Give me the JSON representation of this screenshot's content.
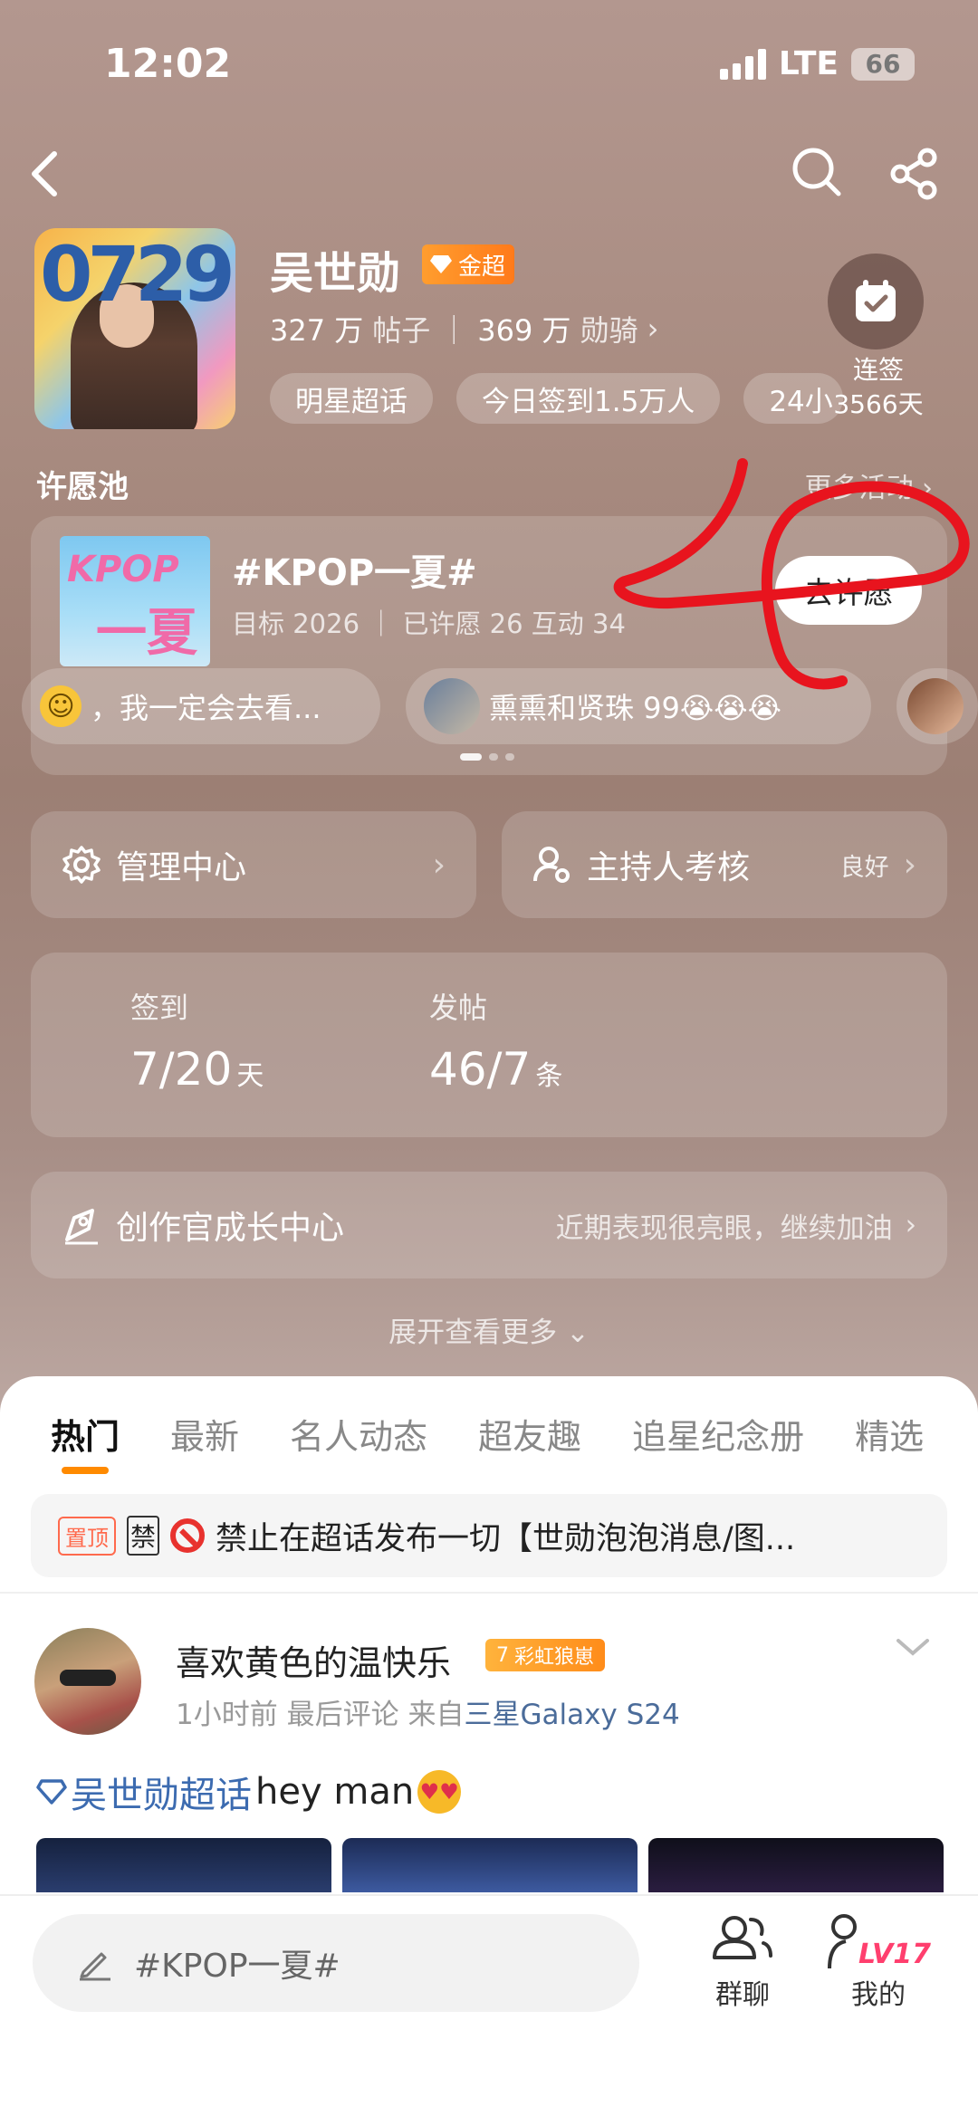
{
  "status_bar": {
    "time": "12:02",
    "network": "LTE",
    "battery": "66"
  },
  "topic": {
    "name": "吴世勋",
    "badge": "金超",
    "posts_count": "327 万",
    "posts_label": "帖子",
    "knights_count": "369 万",
    "knights_label": "勋骑",
    "avatar_text": "0729",
    "chips": [
      "明星超话",
      "今日签到1.5万人",
      "24小"
    ],
    "streak_label": "连签",
    "streak_days": "3566天"
  },
  "wish_pool": {
    "section_title": "许愿池",
    "more_link": "更多活动",
    "title": "#KPOP一夏#",
    "thumb_line1": "KPOP",
    "thumb_line2": "一夏",
    "subtitle": "目标 2026 ｜ 已许愿 26 互动 34",
    "button": "去许愿",
    "bubbles": [
      {
        "text": "，我一定会去看..."
      },
      {
        "text": "熏熏和贤珠 99😭😭😭"
      }
    ]
  },
  "admin": {
    "manage_label": "管理中心",
    "host_label": "主持人考核",
    "host_status": "良好"
  },
  "stats": {
    "signin_label": "签到",
    "signin_value": "7/20",
    "signin_unit": "天",
    "posts_label": "发帖",
    "posts_value": "46/7",
    "posts_unit": "条"
  },
  "growth": {
    "label": "创作官成长中心",
    "note": "近期表现很亮眼，继续加油"
  },
  "expand_label": "展开查看更多",
  "tabs": [
    "热门",
    "最新",
    "名人动态",
    "超友趣",
    "追星纪念册",
    "精选"
  ],
  "pinned": {
    "tag": "置顶",
    "ban_char": "禁",
    "text": "禁止在超话发布一切【世勋泡泡消息/图..."
  },
  "post": {
    "author": "喜欢黄色的温快乐",
    "badge_level": "7",
    "badge_text": "彩虹狼崽",
    "time": "1小时前",
    "last_comment": "最后评论",
    "from_label": "来自",
    "device": "三星Galaxy S24",
    "topic_link": "吴世勋超话",
    "body": "hey man"
  },
  "compose": {
    "placeholder": "#KPOP一夏#"
  },
  "nav": {
    "group_chat": "群聊",
    "mine": "我的",
    "level": "LV17"
  },
  "colors": {
    "accent": "#ff8a00",
    "annotation": "#e8141e",
    "link": "#3c6bb0",
    "gold": "#ff8a1a"
  }
}
